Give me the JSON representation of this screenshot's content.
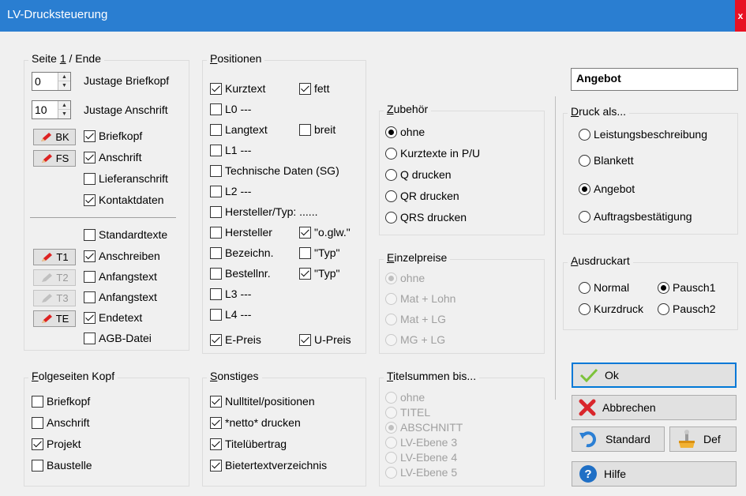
{
  "window": {
    "title": "LV-Drucksteuerung",
    "close": "x"
  },
  "seite": {
    "legend_pre": "Seite ",
    "legend_key": "1",
    "legend_post": " / Ende",
    "spin1_value": "0",
    "spin1_label": "Justage Briefkopf",
    "spin2_value": "10",
    "spin2_label": "Justage Anschrift",
    "bk_button": "BK",
    "fs_button": "FS",
    "briefkopf": "Briefkopf",
    "anschrift": "Anschrift",
    "lieferanschrift": "Lieferanschrift",
    "kontaktdaten": "Kontaktdaten",
    "standardtexte": "Standardtexte",
    "t1_button": "T1",
    "t2_button": "T2",
    "t3_button": "T3",
    "te_button": "TE",
    "anschreiben": "Anschreiben",
    "anfangstext1": "Anfangstext",
    "anfangstext2": "Anfangstext",
    "endetext": "Endetext",
    "agb": "AGB-Datei"
  },
  "folgeseiten": {
    "legend_key": "F",
    "legend_post": "olgeseiten Kopf",
    "items": [
      "Briefkopf",
      "Anschrift",
      "Projekt",
      "Baustelle"
    ]
  },
  "positionen": {
    "legend_key": "P",
    "legend_post": "ositionen",
    "kurztext": "Kurztext",
    "fett": "fett",
    "l0": "L0 ---",
    "langtext": "Langtext",
    "breit": "breit",
    "l1": "L1 ---",
    "techdaten": "Technische Daten (SG)",
    "l2": "L2 ---",
    "herstellertyp": "Hersteller/Typ: ......",
    "hersteller": "Hersteller",
    "oglw": "\"o.glw.\"",
    "bezeichn": "Bezeichn.",
    "typ1": "\"Typ\"",
    "bestellnr": "Bestellnr.",
    "typ2": "\"Typ\"",
    "l3": "L3 ---",
    "l4": "L4 ---",
    "epreis": "E-Preis",
    "upreis": "U-Preis"
  },
  "sonstiges": {
    "legend_key": "S",
    "legend_post": "onstiges",
    "items": [
      "Nulltitel/positionen",
      "*netto* drucken",
      "Titelübertrag",
      "Bietertextverzeichnis"
    ]
  },
  "zubehoer": {
    "legend_key": "Z",
    "legend_post": "ubehör",
    "items": [
      "ohne",
      "Kurztexte in P/U",
      "Q drucken",
      "QR drucken",
      "QRS drucken"
    ]
  },
  "einzelpreise": {
    "legend_key": "E",
    "legend_post": "inzelpreise",
    "items": [
      "ohne",
      "Mat + Lohn",
      "Mat + LG",
      "MG + LG"
    ]
  },
  "titelsummen": {
    "legend_key": "T",
    "legend_post": "itelsummen bis...",
    "items": [
      "ohne",
      "TITEL",
      "ABSCHNITT",
      "LV-Ebene 3",
      "LV-Ebene 4",
      "LV-Ebene 5"
    ]
  },
  "angebot_field": {
    "value": "Angebot"
  },
  "druck_als": {
    "legend_key": "D",
    "legend_post": "ruck als...",
    "items": [
      "Leistungsbeschreibung",
      "Blankett",
      "Angebot",
      "Auftragsbestätigung"
    ]
  },
  "ausdruckart": {
    "legend_key": "A",
    "legend_post": "usdruckart",
    "normal": "Normal",
    "pausch1": "Pausch1",
    "kurzdruck": "Kurzdruck",
    "pausch2": "Pausch2"
  },
  "buttons": {
    "ok": "Ok",
    "abbrechen": "Abbrechen",
    "standard": "Standard",
    "def": "Def",
    "hilfe": "Hilfe"
  },
  "colors": {
    "titlebar": "#2a7ed1",
    "close": "#e81123",
    "default_border": "#0078d7"
  }
}
